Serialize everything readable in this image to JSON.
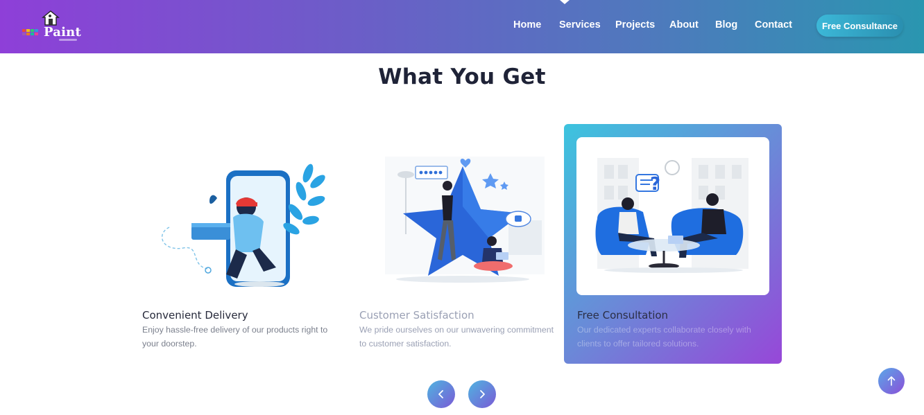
{
  "brand": {
    "name": "Paint",
    "logo_icon": "house-icon"
  },
  "nav": {
    "items": [
      "Home",
      "Services",
      "Projects",
      "About",
      "Blog",
      "Contact"
    ],
    "cta": "Free Consultance"
  },
  "section": {
    "title": "What You Get"
  },
  "cards": [
    {
      "title": "Convenient Delivery",
      "description": "Enjoy hassle-free delivery of our products right to your doorstep.",
      "illustration": "delivery-illustration"
    },
    {
      "title": "Customer Satisfaction",
      "description": "We pride ourselves on our unwavering commitment to customer satisfaction.",
      "illustration": "satisfaction-illustration"
    },
    {
      "title": "Free Consultation",
      "description": "Our dedicated experts collaborate closely with clients to offer tailored solutions.",
      "illustration": "consultation-illustration"
    }
  ],
  "colors": {
    "brand_gradient_start": "#8e3fd8",
    "brand_gradient_end": "#2a96b0",
    "title_color": "#1f2337"
  }
}
